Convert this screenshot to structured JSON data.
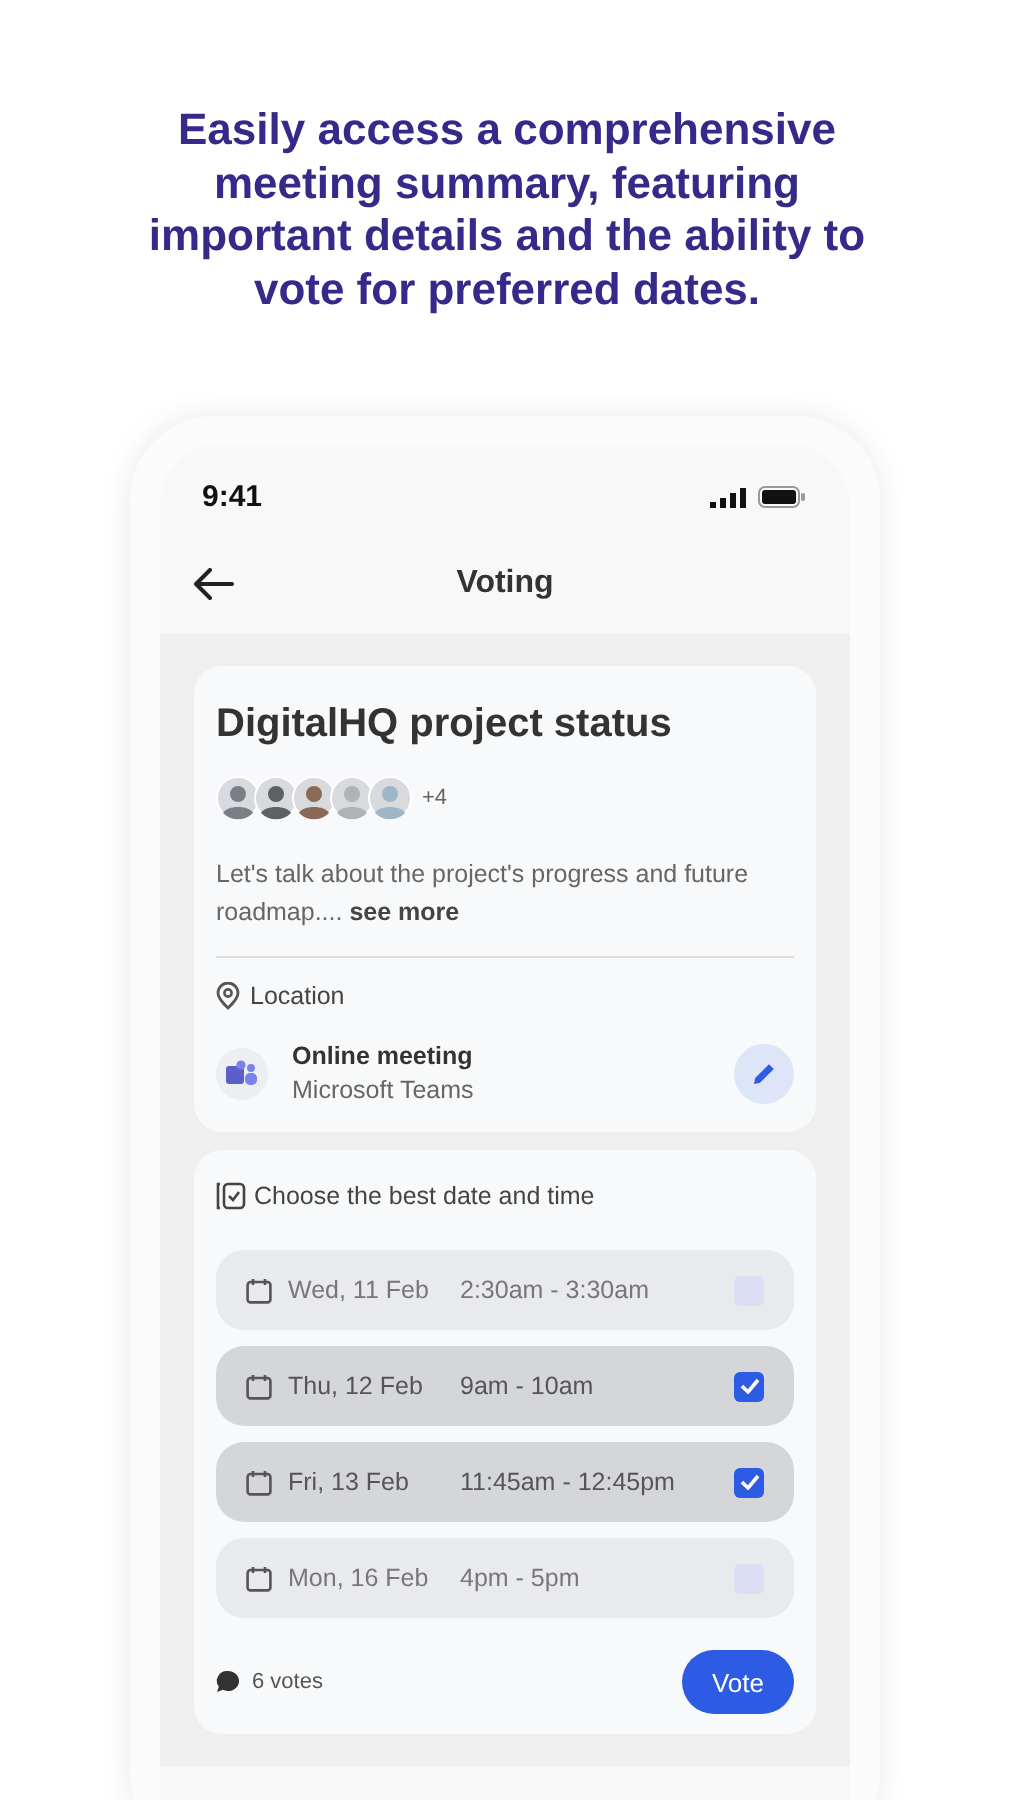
{
  "headline": "Easily access a comprehensive meeting summary, featuring important details and the ability to vote for preferred dates.",
  "status_bar": {
    "time": "9:41"
  },
  "nav": {
    "title": "Voting"
  },
  "meeting": {
    "title": "DigitalHQ project status",
    "more_participants": "+4",
    "description": "Let's talk about the project's progress and future roadmap....",
    "see_more": "see more"
  },
  "location": {
    "label": "Location",
    "name": "Online meeting",
    "detail": "Microsoft Teams"
  },
  "poll": {
    "title": "Choose the best date and time",
    "options": [
      {
        "date": "Wed, 11 Feb",
        "time": "2:30am - 3:30am",
        "checked": false
      },
      {
        "date": "Thu, 12 Feb",
        "time": "9am - 10am",
        "checked": true
      },
      {
        "date": "Fri, 13 Feb",
        "time": "11:45am - 12:45pm",
        "checked": true
      },
      {
        "date": "Mon, 16 Feb",
        "time": "4pm - 5pm",
        "checked": false
      }
    ],
    "votes": "6 votes",
    "vote_button": "Vote"
  }
}
